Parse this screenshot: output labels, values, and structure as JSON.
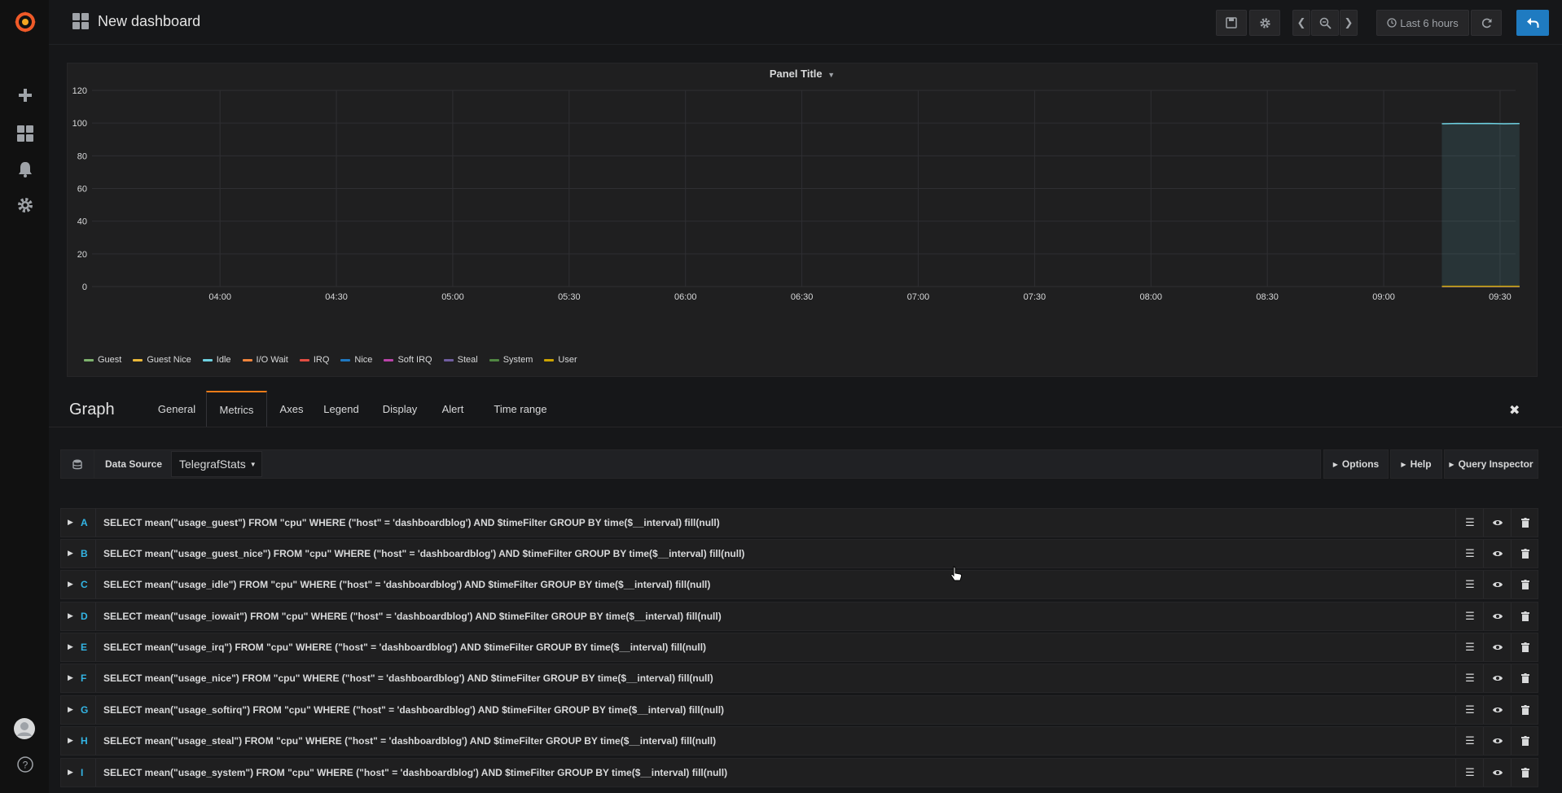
{
  "header": {
    "title": "New dashboard",
    "time_range": "Last 6 hours"
  },
  "sidebar": {
    "items": [
      {
        "icon": "plus-icon",
        "label": "Create"
      },
      {
        "icon": "dashboards-icon",
        "label": "Dashboards"
      },
      {
        "icon": "bell-icon",
        "label": "Alerting"
      },
      {
        "icon": "gear-icon",
        "label": "Configuration"
      }
    ],
    "bottom": [
      {
        "icon": "avatar"
      },
      {
        "icon": "help-icon"
      }
    ]
  },
  "panel": {
    "title": "Panel Title"
  },
  "chart_data": {
    "type": "area",
    "title": "Panel Title",
    "xlabel": "",
    "ylabel": "",
    "ylim": [
      0,
      120
    ],
    "y_ticks": [
      "0",
      "20",
      "40",
      "60",
      "80",
      "100",
      "120"
    ],
    "x_ticks": [
      "04:00",
      "04:30",
      "05:00",
      "05:30",
      "06:00",
      "06:30",
      "07:00",
      "07:30",
      "08:00",
      "08:30",
      "09:00",
      "09:30"
    ],
    "x_range": [
      "03:27",
      "09:34"
    ],
    "grid": true,
    "legend_position": "bottom-left",
    "data_window": [
      "09:15",
      "09:35"
    ],
    "series": [
      {
        "name": "Guest",
        "color": "#7eb26d",
        "values": [
          0
        ]
      },
      {
        "name": "Guest Nice",
        "color": "#eab839",
        "values": [
          0
        ]
      },
      {
        "name": "Idle",
        "color": "#6ed0e0",
        "values": [
          99.6,
          99.8,
          99.7,
          99.8,
          99.6,
          99.7
        ]
      },
      {
        "name": "I/O Wait",
        "color": "#ef843c",
        "values": [
          0
        ]
      },
      {
        "name": "IRQ",
        "color": "#e24d42",
        "values": [
          0
        ]
      },
      {
        "name": "Nice",
        "color": "#1f78c1",
        "values": [
          0
        ]
      },
      {
        "name": "Soft IRQ",
        "color": "#ba43a9",
        "values": [
          0
        ]
      },
      {
        "name": "Steal",
        "color": "#705da0",
        "values": [
          0
        ]
      },
      {
        "name": "System",
        "color": "#508642",
        "values": [
          0.1
        ]
      },
      {
        "name": "User",
        "color": "#cca300",
        "values": [
          0.2
        ]
      }
    ]
  },
  "editor": {
    "title": "Graph",
    "tabs": [
      "General",
      "Metrics",
      "Axes",
      "Legend",
      "Display",
      "Alert",
      "Time range"
    ],
    "active_tab": "Metrics",
    "data_source_label": "Data Source",
    "data_source_value": "TelegrafStats",
    "options_label": "Options",
    "help_label": "Help",
    "query_inspector_label": "Query Inspector"
  },
  "queries": [
    {
      "letter": "A",
      "text": "SELECT mean(\"usage_guest\") FROM \"cpu\" WHERE (\"host\" = 'dashboardblog') AND $timeFilter GROUP BY time($__interval) fill(null)"
    },
    {
      "letter": "B",
      "text": "SELECT mean(\"usage_guest_nice\") FROM \"cpu\" WHERE (\"host\" = 'dashboardblog') AND $timeFilter GROUP BY time($__interval) fill(null)"
    },
    {
      "letter": "C",
      "text": "SELECT mean(\"usage_idle\") FROM \"cpu\" WHERE (\"host\" = 'dashboardblog') AND $timeFilter GROUP BY time($__interval) fill(null)"
    },
    {
      "letter": "D",
      "text": "SELECT mean(\"usage_iowait\") FROM \"cpu\" WHERE (\"host\" = 'dashboardblog') AND $timeFilter GROUP BY time($__interval) fill(null)"
    },
    {
      "letter": "E",
      "text": "SELECT mean(\"usage_irq\") FROM \"cpu\" WHERE (\"host\" = 'dashboardblog') AND $timeFilter GROUP BY time($__interval) fill(null)"
    },
    {
      "letter": "F",
      "text": "SELECT mean(\"usage_nice\") FROM \"cpu\" WHERE (\"host\" = 'dashboardblog') AND $timeFilter GROUP BY time($__interval) fill(null)"
    },
    {
      "letter": "G",
      "text": "SELECT mean(\"usage_softirq\") FROM \"cpu\" WHERE (\"host\" = 'dashboardblog') AND $timeFilter GROUP BY time($__interval) fill(null)"
    },
    {
      "letter": "H",
      "text": "SELECT mean(\"usage_steal\") FROM \"cpu\" WHERE (\"host\" = 'dashboardblog') AND $timeFilter GROUP BY time($__interval) fill(null)"
    },
    {
      "letter": "I",
      "text": "SELECT mean(\"usage_system\") FROM \"cpu\" WHERE (\"host\" = 'dashboardblog') AND $timeFilter GROUP BY time($__interval) fill(null)"
    }
  ],
  "colors": {
    "accent": "#eb7b18",
    "primary_button": "#1f7bc1",
    "query_letter": "#33b5e5"
  }
}
